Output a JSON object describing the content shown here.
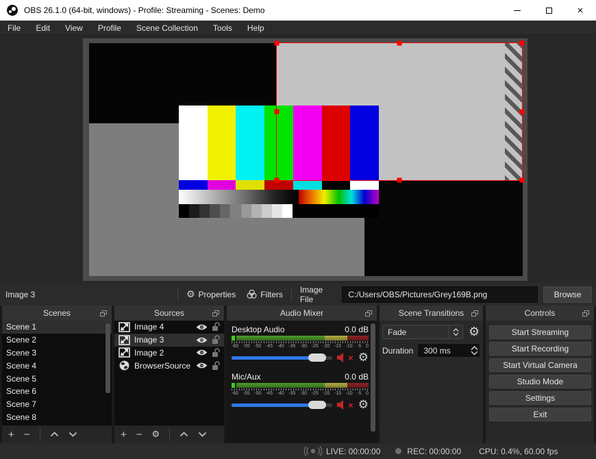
{
  "window": {
    "title": "OBS 26.1.0 (64-bit, windows) - Profile: Streaming - Scenes: Demo"
  },
  "menu": {
    "items": [
      "File",
      "Edit",
      "View",
      "Profile",
      "Scene Collection",
      "Tools",
      "Help"
    ]
  },
  "toolbar": {
    "source_label": "Image 3",
    "properties_label": "Properties",
    "filters_label": "Filters",
    "image_file_label": "Image File",
    "image_file_value": "C:/Users/OBS/Pictures/Grey169B.png",
    "browse_label": "Browse"
  },
  "docks": {
    "scenes": {
      "title": "Scenes",
      "items": [
        "Scene 1",
        "Scene 2",
        "Scene 3",
        "Scene 4",
        "Scene 5",
        "Scene 6",
        "Scene 7",
        "Scene 8"
      ],
      "selected": "Scene 1"
    },
    "sources": {
      "title": "Sources",
      "items": [
        {
          "name": "Image 4",
          "type": "image"
        },
        {
          "name": "Image 3",
          "type": "image"
        },
        {
          "name": "Image 2",
          "type": "image"
        },
        {
          "name": "BrowserSource",
          "type": "browser"
        }
      ],
      "selected": "Image 3"
    },
    "mixer": {
      "title": "Audio Mixer",
      "scale": [
        "-60",
        "-55",
        "-50",
        "-45",
        "-40",
        "-35",
        "-30",
        "-25",
        "-20",
        "-15",
        "-10",
        "-5",
        "0"
      ],
      "channels": [
        {
          "name": "Desktop Audio",
          "level": "0.0 dB",
          "muted": true
        },
        {
          "name": "Mic/Aux",
          "level": "0.0 dB",
          "muted": true
        }
      ]
    },
    "transitions": {
      "title": "Scene Transitions",
      "transition_value": "Fade",
      "duration_label": "Duration",
      "duration_value": "300 ms"
    },
    "controls": {
      "title": "Controls",
      "buttons": [
        "Start Streaming",
        "Start Recording",
        "Start Virtual Camera",
        "Studio Mode",
        "Settings",
        "Exit"
      ]
    }
  },
  "statusbar": {
    "live": "LIVE: 00:00:00",
    "rec": "REC: 00:00:00",
    "cpu": "CPU: 0.4%, 60.00 fps"
  },
  "colors": {
    "selection_red": "#ff0000",
    "slider_blue": "#2e77e6",
    "mute_red": "#cc2222",
    "meter_green": "#3f7d23",
    "meter_yellow": "#9d9b36",
    "meter_red": "#7c1f1f",
    "titlebar_bg": "#ffffff",
    "panel_header_bg": "#333333",
    "list_bg": "#0d0d0d",
    "selected_row_bg": "#2f2f2f"
  }
}
